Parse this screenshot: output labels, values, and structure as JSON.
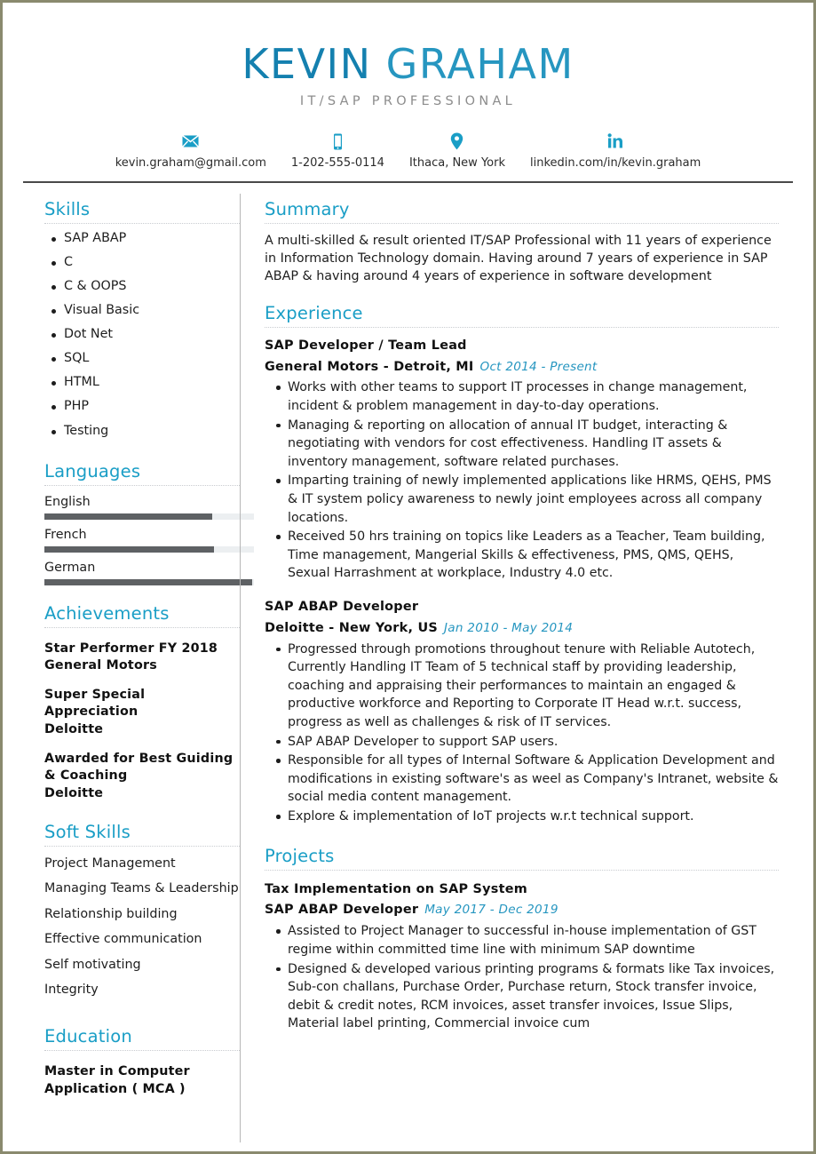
{
  "theme": {
    "accent": "#1a9ec6",
    "name_first_color": "#1480af",
    "name_last_color": "#2696c0",
    "subtitle_color": "#8c8c8c",
    "text_color": "#1d1d1d",
    "bar_fill": "#5e6164",
    "bar_track": "#eceff1",
    "page_border": "#8a8a6e"
  },
  "header": {
    "first_name": "KEVIN",
    "last_name": "GRAHAM",
    "subtitle": "IT/SAP PROFESSIONAL",
    "contacts": [
      {
        "icon": "email-icon",
        "text": "kevin.graham@gmail.com"
      },
      {
        "icon": "phone-icon",
        "text": "1-202-555-0114"
      },
      {
        "icon": "location-pin-icon",
        "text": "Ithaca, New York"
      },
      {
        "icon": "linkedin-icon",
        "text": "linkedin.com/in/kevin.graham"
      }
    ]
  },
  "sidebar": {
    "skills": {
      "heading": "Skills",
      "items": [
        "SAP ABAP",
        "C",
        "C & OOPS",
        "Visual Basic",
        "Dot Net",
        "SQL",
        "HTML",
        "PHP",
        "Testing"
      ]
    },
    "languages": {
      "heading": "Languages",
      "items": [
        {
          "name": "English",
          "level": 80
        },
        {
          "name": "French",
          "level": 81
        },
        {
          "name": "German",
          "level": 99
        }
      ]
    },
    "achievements": {
      "heading": "Achievements",
      "items": [
        {
          "title": "Star Performer FY 2018",
          "org": "General Motors"
        },
        {
          "title": "Super Special Appreciation",
          "org": "Deloitte"
        },
        {
          "title": "Awarded for Best Guiding & Coaching",
          "org": "Deloitte"
        }
      ]
    },
    "soft_skills": {
      "heading": "Soft Skills",
      "items": [
        "Project Management",
        "Managing Teams & Leadership",
        "Relationship building",
        "Effective communication",
        "Self motivating",
        "Integrity"
      ]
    },
    "education": {
      "heading": "Education",
      "items": [
        {
          "degree": "Master in Computer Application ( MCA )"
        }
      ]
    }
  },
  "main": {
    "summary": {
      "heading": "Summary",
      "text": "A multi-skilled & result oriented IT/SAP Professional with 11 years of experience in Information Technology domain. Having around 7 years of experience in SAP ABAP & having around 4 years of experience in software development"
    },
    "experience": {
      "heading": "Experience",
      "jobs": [
        {
          "role": "SAP Developer / Team Lead",
          "company": "General Motors - Detroit, MI",
          "dates": "Oct 2014 - Present",
          "bullets": [
            "Works with other teams to support IT processes in change management, incident & problem management in day-to-day operations.",
            "Managing & reporting on allocation of annual IT budget, interacting & negotiating with vendors for cost effectiveness. Handling IT assets & inventory management, software related purchases.",
            "Imparting training of newly implemented applications like HRMS, QEHS, PMS & IT system policy awareness to newly joint employees across all company locations.",
            "Received 50 hrs training on topics like Leaders as a Teacher, Team building, Time management, Mangerial Skills & effectiveness, PMS, QMS, QEHS, Sexual Harrashment at workplace, Industry 4.0 etc."
          ]
        },
        {
          "role": "SAP ABAP Developer",
          "company": "Deloitte - New York, US",
          "dates": "Jan 2010 - May 2014",
          "bullets": [
            "Progressed through promotions throughout tenure with Reliable Autotech, Currently Handling IT Team of 5 technical staff by providing leadership, coaching and appraising their performances to maintain an engaged & productive workforce and Reporting to Corporate IT Head w.r.t. success, progress as well as challenges & risk of IT services.",
            "SAP ABAP Developer to support SAP users.",
            "Responsible for all types of Internal Software & Application Development and modifications in existing software's as weel as Company's Intranet, website & social media content management.",
            "Explore & implementation of IoT projects w.r.t technical support."
          ]
        }
      ]
    },
    "projects": {
      "heading": "Projects",
      "items": [
        {
          "name": "Tax Implementation on SAP System",
          "role": "SAP ABAP Developer",
          "dates": "May 2017 - Dec 2019",
          "bullets": [
            "Assisted to Project Manager to successful in-house implementation of GST regime within committed time line with minimum SAP downtime",
            "Designed & developed various printing programs & formats like Tax invoices, Sub-con challans, Purchase Order, Purchase return, Stock transfer invoice, debit & credit notes, RCM invoices, asset transfer invoices, Issue Slips, Material label printing, Commercial invoice cum"
          ]
        }
      ]
    }
  }
}
